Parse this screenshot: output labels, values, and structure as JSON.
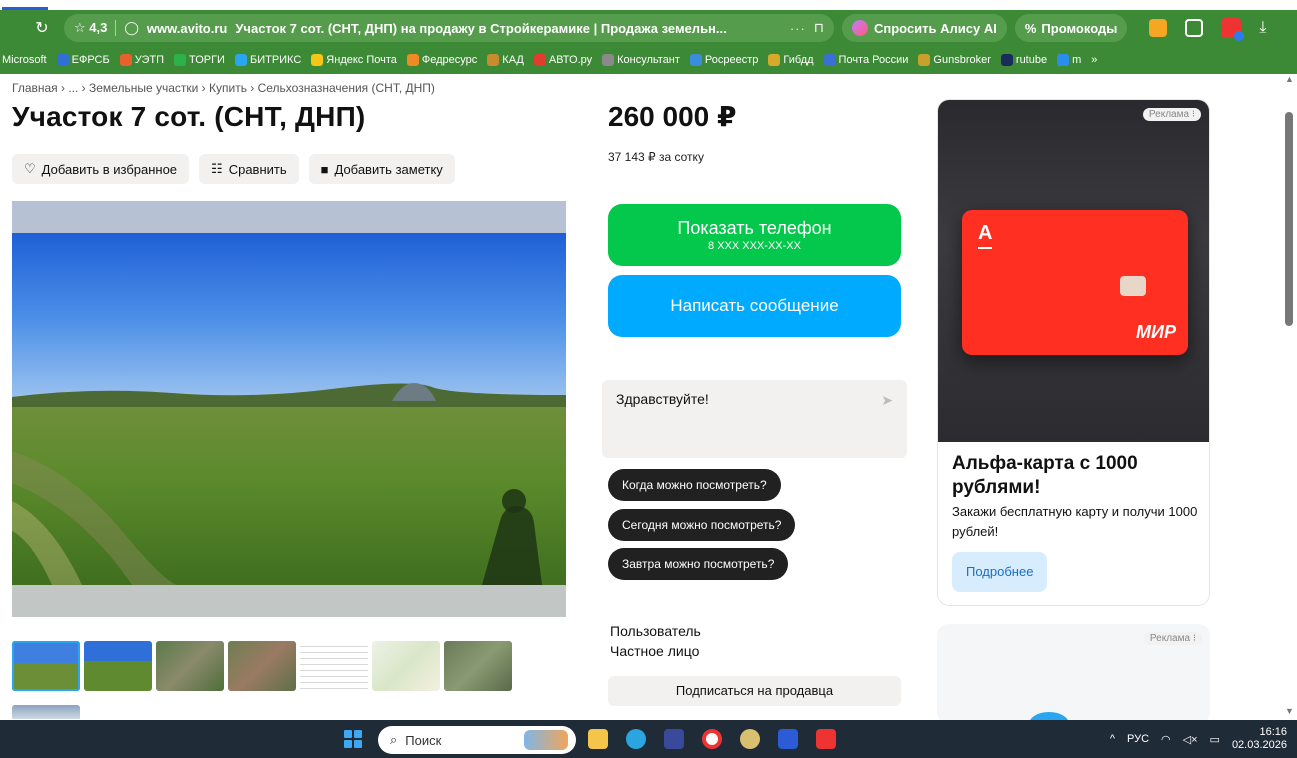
{
  "browser": {
    "rating": "☆ 4,3",
    "url": "www.avito.ru",
    "tab_title": "Участок 7 сот. (СНТ, ДНП) на продажу в Стройкерамике | Продажа земельн...",
    "more": "···",
    "alisa_label": "Спросить Алису AI",
    "promo_label": "Промокоды"
  },
  "bookmarks": [
    {
      "label": "Microsoft",
      "color": "#3d8a36"
    },
    {
      "label": "ЕФРСБ",
      "color": "#2f6fd6"
    },
    {
      "label": "УЭТП",
      "color": "#e8612c"
    },
    {
      "label": "ТОРГИ",
      "color": "#2db24a"
    },
    {
      "label": "БИТРИКС",
      "color": "#2aa5f0"
    },
    {
      "label": "Яндекс Почта",
      "color": "#f5c518"
    },
    {
      "label": "Федресурс",
      "color": "#f08a24"
    },
    {
      "label": "КАД",
      "color": "#c88b2e"
    },
    {
      "label": "АВТО.ру",
      "color": "#e33b2e"
    },
    {
      "label": "Консультант",
      "color": "#8a8a8a"
    },
    {
      "label": "Росреестр",
      "color": "#3b8de0"
    },
    {
      "label": "Гибдд",
      "color": "#d8a92a"
    },
    {
      "label": "Почта России",
      "color": "#3a6fd6"
    },
    {
      "label": "Gunsbroker",
      "color": "#c8a12a"
    },
    {
      "label": "rutube",
      "color": "#1a2b5c"
    },
    {
      "label": "m",
      "color": "#2a8ef0"
    }
  ],
  "bookmarks_more": "»",
  "breadcrumb": "Главная › ... › Земельные участки › Купить › Сельхозназначения (СНТ, ДНП)",
  "title": "Участок 7 сот. (СНТ, ДНП)",
  "actions": {
    "favorite": "Добавить в избранное",
    "compare": "Сравнить",
    "note": "Добавить заметку"
  },
  "price": "260 000 ₽",
  "price_per_are": "37 143 ₽ за сотку",
  "phone_button": {
    "label": "Показать телефон",
    "masked": "8 XXX XXX-XX-XX"
  },
  "message_button": "Написать сообщение",
  "chat": {
    "text": "Здравствуйте!",
    "send_icon": "send-arrow"
  },
  "quick_replies": [
    "Когда можно посмотреть?",
    "Сегодня можно посмотреть?",
    "Завтра можно посмотреть?"
  ],
  "seller": {
    "name": "Пользователь",
    "type": "Частное лицо",
    "subscribe": "Подписаться на продавца"
  },
  "ad1": {
    "badge": "Реклама ⁝",
    "card_letter": "А",
    "card_brand": "МИР",
    "headline": "Альфа-карта с 1000 рублями!",
    "text": "Закажи бесплатную карту и получи 1000 рублей!",
    "button": "Подробнее"
  },
  "ad2": {
    "badge": "Реклама ⁝"
  },
  "taskbar": {
    "search_placeholder": "Поиск",
    "lang": "РУС",
    "time": "16:16",
    "date": "02.03.2026"
  },
  "colors": {
    "browser_green": "#3d8a36",
    "phone_green": "#04c84b",
    "message_blue": "#00aaff",
    "ad_red": "#ff2f22"
  }
}
